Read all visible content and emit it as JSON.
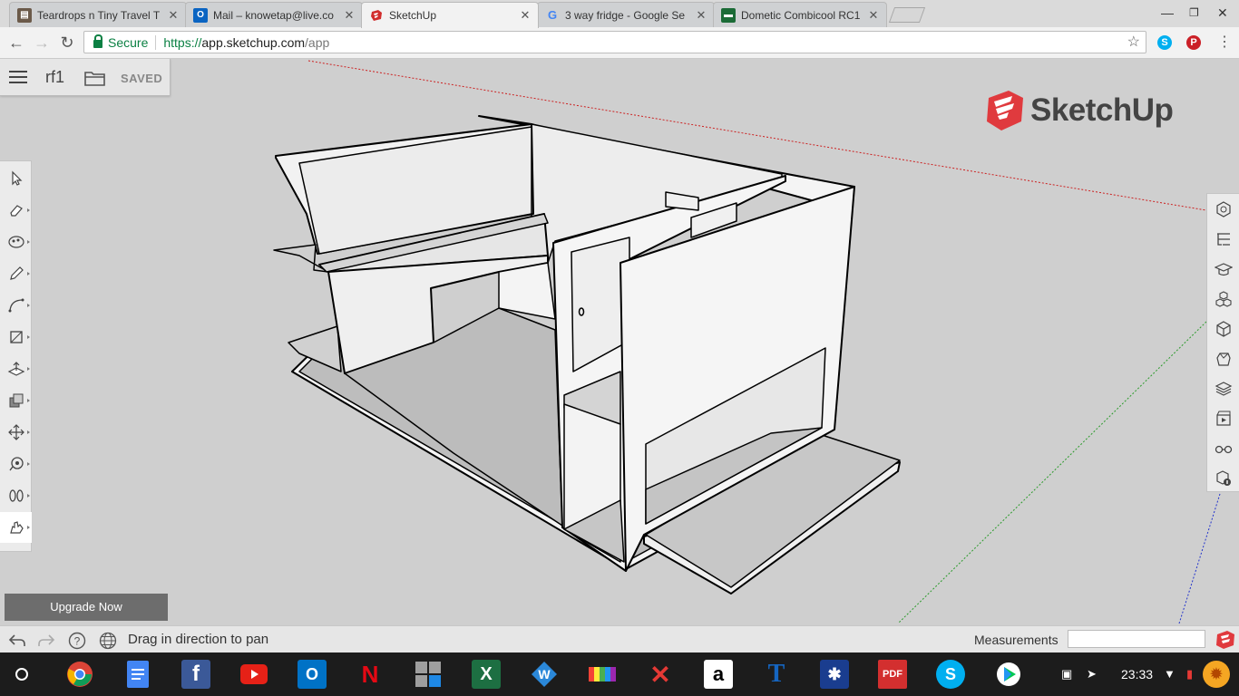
{
  "browser": {
    "tabs": [
      {
        "title": "Teardrops n Tiny Travel T",
        "favicon": "teardrops-favicon",
        "color": "#6b5a4a",
        "active": false
      },
      {
        "title": "Mail – knowetap@live.co",
        "favicon": "outlook-favicon",
        "color": "#0a64c2",
        "active": false
      },
      {
        "title": "SketchUp",
        "favicon": "sketchup-favicon",
        "color": "#d12c2c",
        "active": true
      },
      {
        "title": "3 way fridge - Google Se",
        "favicon": "google-favicon",
        "color": "#4285f4",
        "active": false
      },
      {
        "title": "Dometic Combicool RC1",
        "favicon": "rv-favicon",
        "color": "#1b6b36",
        "active": false
      }
    ],
    "secure_label": "Secure",
    "url": {
      "scheme": "https://",
      "host": "app.sketchup.com",
      "path": "/app"
    }
  },
  "file": {
    "name": "rf1",
    "status": "SAVED"
  },
  "brand": {
    "wordmark": "SketchUp",
    "color": "#e03a3e"
  },
  "left_toolbar": [
    {
      "icon": "select-icon",
      "selected": false
    },
    {
      "icon": "eraser-icon",
      "selected": false
    },
    {
      "icon": "paint-bucket-icon",
      "selected": false
    },
    {
      "icon": "pencil-line-icon",
      "selected": false
    },
    {
      "icon": "arc-icon",
      "selected": false
    },
    {
      "icon": "rectangle-icon",
      "selected": false
    },
    {
      "icon": "push-pull-icon",
      "selected": false
    },
    {
      "icon": "offset-icon",
      "selected": false
    },
    {
      "icon": "move-icon",
      "selected": false
    },
    {
      "icon": "tape-measure-icon",
      "selected": false
    },
    {
      "icon": "walk-icon",
      "selected": false
    },
    {
      "icon": "pan-icon",
      "selected": true
    }
  ],
  "right_toolbar": [
    {
      "icon": "entity-info-icon"
    },
    {
      "icon": "outliner-icon"
    },
    {
      "icon": "instructor-icon"
    },
    {
      "icon": "components-icon"
    },
    {
      "icon": "materials-icon"
    },
    {
      "icon": "styles-icon"
    },
    {
      "icon": "layers-icon"
    },
    {
      "icon": "scenes-icon"
    },
    {
      "icon": "display-icon"
    },
    {
      "icon": "model-info-icon"
    }
  ],
  "upgrade_label": "Upgrade Now",
  "status": {
    "hint": "Drag in direction to pan",
    "measurements_label": "Measurements",
    "measurements_value": ""
  },
  "taskbar": {
    "apps": [
      "launcher",
      "chrome",
      "docs",
      "facebook",
      "youtube",
      "outlook",
      "netflix",
      "calculator",
      "excel",
      "wunderlist",
      "color-bars",
      "app-red",
      "amazon",
      "t-app",
      "snowflake",
      "pdf",
      "skype",
      "play-store"
    ],
    "clock": "23:33"
  }
}
